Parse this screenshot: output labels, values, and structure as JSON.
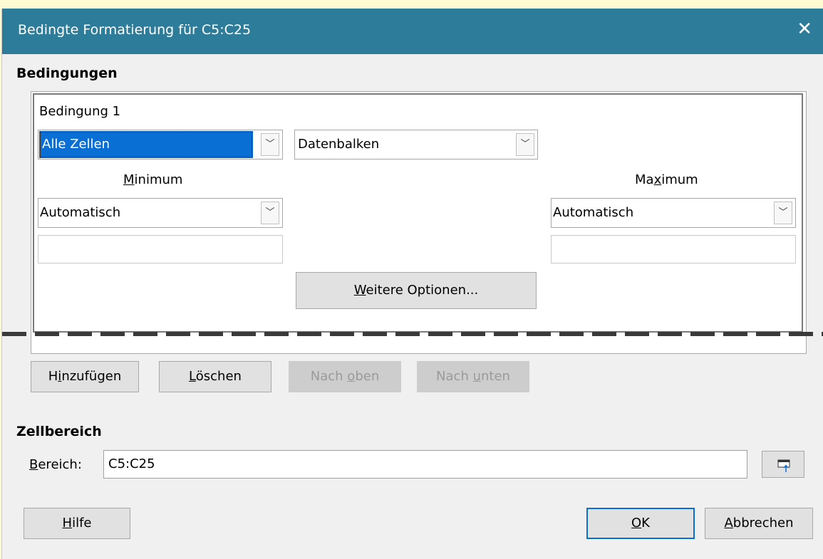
{
  "dialog": {
    "title": "Bedingte Formatierung für C5:C25",
    "close_label": "✕"
  },
  "conditions": {
    "section_label": "Bedingungen",
    "condition_label": "Bedingung 1",
    "scope_value": "Alle Zellen",
    "type_value": "Datenbalken",
    "minimum_label": {
      "pre": "",
      "accel": "M",
      "post": "inimum"
    },
    "maximum_label": {
      "pre": "Ma",
      "accel": "x",
      "post": "imum"
    },
    "minimum_value": "Automatisch",
    "maximum_value": "Automatisch",
    "minimum_input": "",
    "maximum_input": "",
    "more_options": {
      "pre": "",
      "accel": "W",
      "post": "eitere Optionen..."
    }
  },
  "actions": {
    "add": {
      "pre": "H",
      "accel": "i",
      "post": "nzufügen"
    },
    "delete": {
      "pre": "",
      "accel": "L",
      "post": "öschen"
    },
    "up": {
      "pre": "Nach ",
      "accel": "o",
      "post": "ben"
    },
    "down": {
      "pre": "Nach ",
      "accel": "u",
      "post": "nten"
    }
  },
  "cell_range": {
    "section_label": "Zellbereich",
    "range_label": {
      "pre": "",
      "accel": "B",
      "post": "ereich:"
    },
    "range_value": "C5:C25"
  },
  "footer": {
    "help": {
      "pre": "",
      "accel": "H",
      "post": "ilfe"
    },
    "ok": {
      "pre": "",
      "accel": "O",
      "post": "K"
    },
    "cancel": {
      "pre": "",
      "accel": "A",
      "post": "bbrechen"
    }
  },
  "colors": {
    "titlebar": "#2d7c99",
    "selection": "#0a6fd4",
    "dialog_bg": "#f0f0f0"
  }
}
